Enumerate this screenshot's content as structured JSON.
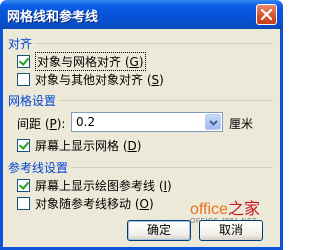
{
  "dialog": {
    "title": "网格线和参考线",
    "close_icon": "close-icon"
  },
  "snap": {
    "heading": "对齐",
    "to_grid": {
      "label": "对象与网格对齐 (",
      "key": "G",
      "suffix": ")",
      "checked": true
    },
    "to_objects": {
      "label": "对象与其他对象对齐 (",
      "key": "S",
      "suffix": ")",
      "checked": false
    }
  },
  "grid": {
    "heading": "网格设置",
    "spacing_label": "间距 (",
    "spacing_key": "P",
    "spacing_suffix": "):",
    "spacing_value": "0.2",
    "spacing_unit": "厘米",
    "show_grid": {
      "label": "屏幕上显示网格 (",
      "key": "D",
      "suffix": ")",
      "checked": true
    }
  },
  "guides": {
    "heading": "参考线设置",
    "show_drawing_guides": {
      "label": "屏幕上显示绘图参考线 (",
      "key": "I",
      "suffix": ")",
      "checked": true
    },
    "move_with_guides": {
      "label": "对象随参考线移动 (",
      "key": "O",
      "suffix": ")",
      "checked": false
    }
  },
  "buttons": {
    "ok": "确定",
    "cancel": "取消"
  },
  "watermark": {
    "main_a": "office",
    "main_b": "之家",
    "sub": "OFFICE.JB51.NET"
  }
}
